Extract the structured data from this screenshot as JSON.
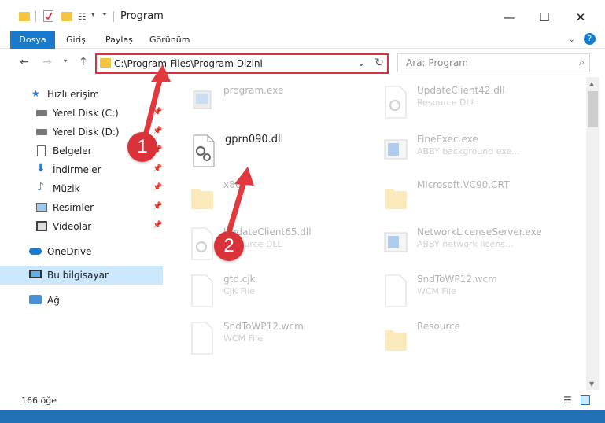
{
  "window": {
    "title": "Program",
    "minimize": "—",
    "maximize": "☐",
    "close": "✕"
  },
  "ribbon": {
    "tabs": [
      "Dosya",
      "Giriş",
      "Paylaş",
      "Görünüm"
    ]
  },
  "address": {
    "path": "C:\\Program Files\\Program Dizini",
    "search_placeholder": "Ara: Program"
  },
  "sidebar": {
    "items": [
      {
        "label": "Hızlı erişim",
        "icon": "star-icon",
        "pinned": false
      },
      {
        "label": "Yerel Disk (C:)",
        "icon": "drive-icon",
        "pinned": true
      },
      {
        "label": "Yerel Disk (D:)",
        "icon": "drive-icon",
        "pinned": true
      },
      {
        "label": "Belgeler",
        "icon": "documents-icon",
        "pinned": true
      },
      {
        "label": "İndirmeler",
        "icon": "download-icon",
        "pinned": true
      },
      {
        "label": "Müzik",
        "icon": "music-icon",
        "pinned": true
      },
      {
        "label": "Resimler",
        "icon": "pictures-icon",
        "pinned": true
      },
      {
        "label": "Videolar",
        "icon": "videos-icon",
        "pinned": true
      },
      {
        "label": "OneDrive",
        "icon": "cloud-icon",
        "pinned": false
      },
      {
        "label": "Bu bilgisayar",
        "icon": "computer-icon",
        "pinned": false
      },
      {
        "label": "Ağ",
        "icon": "network-icon",
        "pinned": false
      }
    ]
  },
  "files": [
    {
      "name": "program.exe",
      "sub": ""
    },
    {
      "name": "UpdateClient42.dll",
      "sub": "Resource DLL"
    },
    {
      "name": "gprn090.dll",
      "sub": ""
    },
    {
      "name": "FineExec.exe",
      "sub": "ABBY background exe..."
    },
    {
      "name": "x86",
      "sub": ""
    },
    {
      "name": "Microsoft.VC90.CRT",
      "sub": ""
    },
    {
      "name": "UpdateClient65.dll",
      "sub": "Resource DLL"
    },
    {
      "name": "NetworkLicenseServer.exe",
      "sub": "ABBY network licens..."
    },
    {
      "name": "gtd.cjk",
      "sub": "CJK File"
    },
    {
      "name": "SndToWP12.wcm",
      "sub": "WCM File"
    },
    {
      "name": "SndToWP12.wcm",
      "sub": "WCM File"
    },
    {
      "name": "Resource",
      "sub": ""
    }
  ],
  "status": {
    "count": "166 öğe"
  },
  "annotations": {
    "step1": "1",
    "step2": "2",
    "color": "#d9323a"
  }
}
